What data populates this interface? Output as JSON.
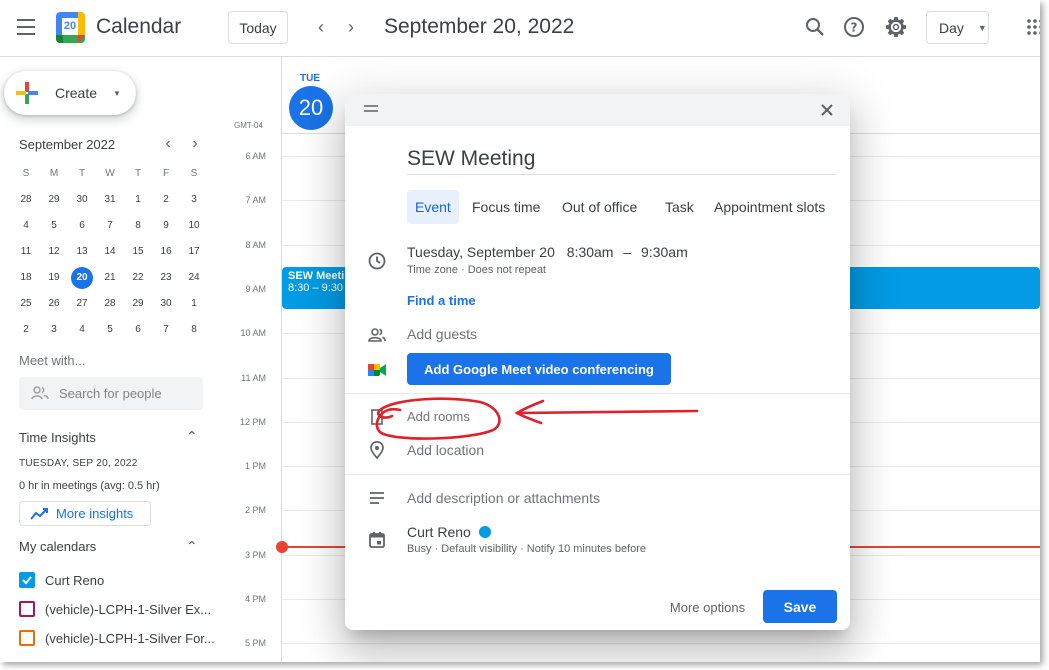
{
  "header": {
    "app_title": "Calendar",
    "logo_day": "20",
    "today_label": "Today",
    "date_title": "September 20, 2022",
    "view_select": "Day",
    "icons": [
      "menu-icon",
      "search-icon",
      "help-icon",
      "settings-icon",
      "apps-icon"
    ]
  },
  "sidebar": {
    "create_label": "Create",
    "mini_calendar": {
      "title": "September 2022",
      "weekdays": [
        "S",
        "M",
        "T",
        "W",
        "T",
        "F",
        "S"
      ],
      "weeks": [
        [
          "28",
          "29",
          "30",
          "31",
          "1",
          "2",
          "3"
        ],
        [
          "4",
          "5",
          "6",
          "7",
          "8",
          "9",
          "10"
        ],
        [
          "11",
          "12",
          "13",
          "14",
          "15",
          "16",
          "17"
        ],
        [
          "18",
          "19",
          "20",
          "21",
          "22",
          "23",
          "24"
        ],
        [
          "25",
          "26",
          "27",
          "28",
          "29",
          "30",
          "1"
        ],
        [
          "2",
          "3",
          "4",
          "5",
          "6",
          "7",
          "8"
        ]
      ],
      "selected": "20"
    },
    "meet_with": "Meet with...",
    "search_placeholder": "Search for people",
    "time_insights": {
      "title": "Time Insights",
      "date": "TUESDAY, SEP 20, 2022",
      "summary": "0 hr in meetings (avg: 0.5 hr)",
      "more_label": "More insights"
    },
    "my_calendars": {
      "title": "My calendars",
      "items": [
        {
          "label": "Curt Reno",
          "color": "#039be5",
          "checked": true
        },
        {
          "label": "(vehicle)-LCPH-1-Silver Ex...",
          "color": "#ad1457",
          "checked": false
        },
        {
          "label": "(vehicle)-LCPH-1-Silver For...",
          "color": "#ef6c00",
          "checked": false
        }
      ]
    }
  },
  "day_view": {
    "day_name": "TUE",
    "day_number": "20",
    "timezone": "GMT-04",
    "hours": [
      "6 AM",
      "7 AM",
      "8 AM",
      "9 AM",
      "10 AM",
      "11 AM",
      "12 PM",
      "1 PM",
      "2 PM",
      "3 PM",
      "4 PM",
      "5 PM"
    ],
    "event": {
      "title": "SEW Meetin",
      "time": "8:30 – 9:30"
    }
  },
  "dialog": {
    "title": "SEW Meeting",
    "tabs": [
      "Event",
      "Focus time",
      "Out of office",
      "Task",
      "Appointment slots"
    ],
    "date": "Tuesday, September 20",
    "start": "8:30am",
    "dash": "–",
    "end": "9:30am",
    "recurrence": "Time zone · Does not repeat",
    "find_time": "Find a time",
    "add_guests": "Add guests",
    "meet_button": "Add Google Meet video conferencing",
    "add_rooms": "Add rooms",
    "add_location": "Add location",
    "add_description": "Add description or attachments",
    "organizer": "Curt Reno",
    "organizer_details": "Busy · Default visibility · Notify 10 minutes before",
    "more_options": "More options",
    "save": "Save"
  },
  "colors": {
    "accent": "#1a73e8",
    "event": "#039be5",
    "annotation": "#e0202a",
    "now_line": "#ea4335"
  }
}
